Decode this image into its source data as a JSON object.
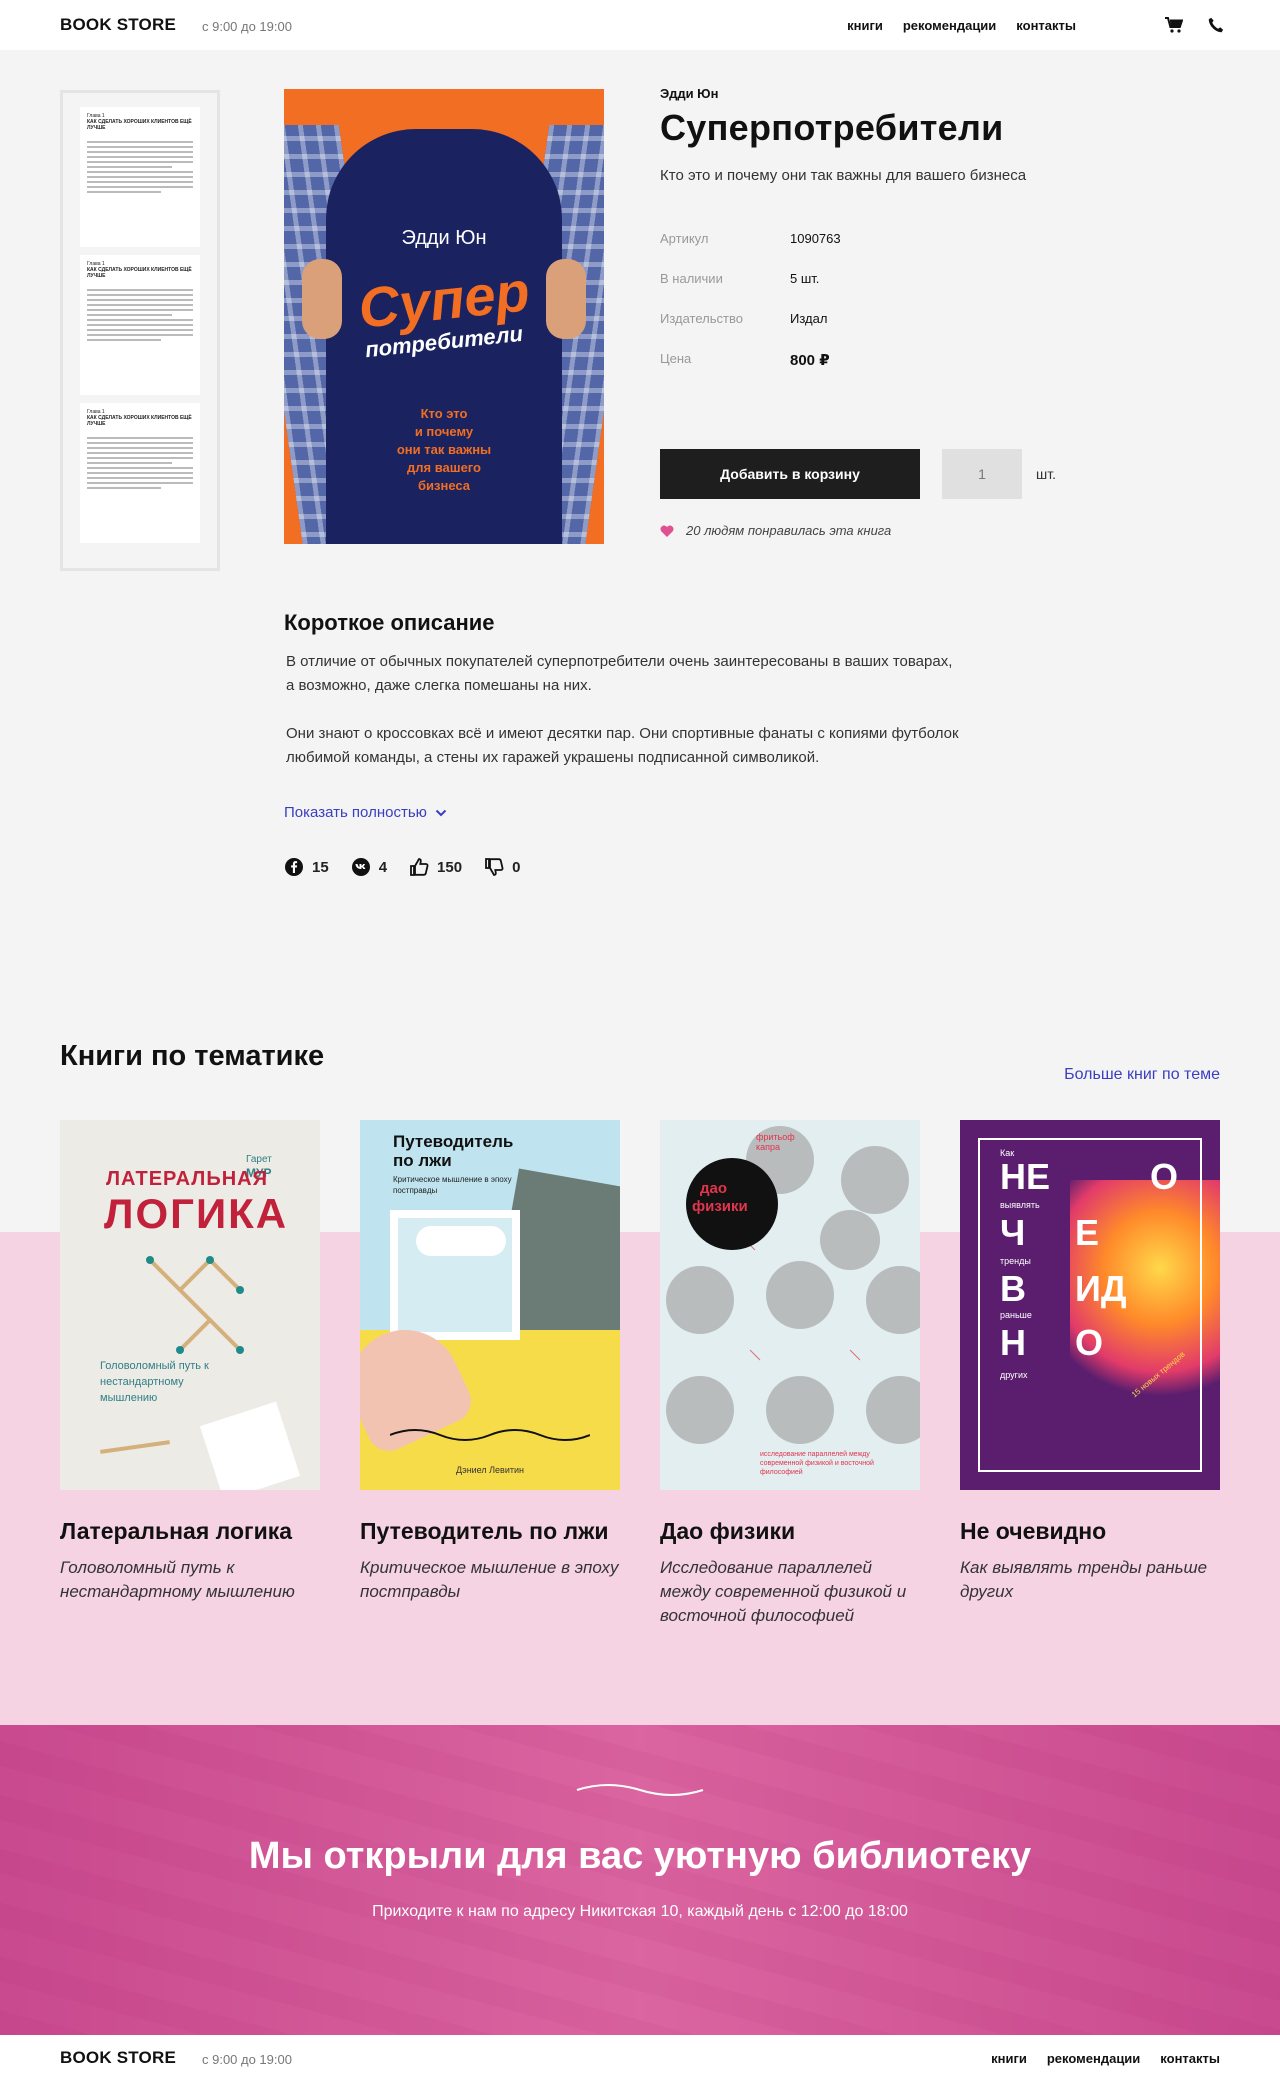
{
  "header": {
    "logo": "BOOK STORE",
    "hours": "с 9:00 до 19:00",
    "nav": [
      "книги",
      "рекомендации",
      "контакты"
    ],
    "icons": [
      "cart-icon",
      "phone-icon"
    ]
  },
  "product": {
    "author": "Эдди Юн",
    "title": "Суперпотребители",
    "subtitle": "Кто это и почему они так важны для вашего бизнеса",
    "specs": [
      {
        "label": "Артикул",
        "value": "1090763"
      },
      {
        "label": "В наличии",
        "value": "5 шт."
      },
      {
        "label": "Издательство",
        "value": "Издал"
      },
      {
        "label": "Цена",
        "value": "800 ₽"
      }
    ],
    "add_to_cart": "Добавить в корзину",
    "quantity": "1",
    "unit": "шт.",
    "likes_text": "20 людям понравилась эта книга",
    "cover": {
      "author": "Эдди Юн",
      "title_line1": "Супер",
      "title_line2": "потребители",
      "subtitle": "Кто это\nи почему\nони так важны\nдля вашего\nбизнеса"
    },
    "preview_pages": [
      {
        "chapter": "Глава 1",
        "heading": "КАК СДЕЛАТЬ ХОРОШИХ КЛИЕНТОВ ЕЩЁ ЛУЧШЕ"
      },
      {
        "chapter": "Глава 1",
        "heading": "КАК СДЕЛАТЬ ХОРОШИХ КЛИЕНТОВ ЕЩЁ ЛУЧШЕ"
      },
      {
        "chapter": "Глава 1",
        "heading": "КАК СДЕЛАТЬ ХОРОШИХ КЛИЕНТОВ ЕЩЁ ЛУЧШЕ"
      }
    ]
  },
  "description": {
    "heading": "Короткое описание",
    "paragraphs": [
      "В отличие от обычных покупателей суперпотребители очень заинтересованы в ваших товарах, а возможно, даже слегка помешаны на них.",
      "Они знают о кроссовках всё и имеют десятки пар. Они спортивные фанаты с копиями футболок любимой команды, а стены их гаражей украшены подписанной символикой."
    ],
    "show_more": "Показать полностью",
    "social": [
      {
        "icon": "facebook-icon",
        "count": "15"
      },
      {
        "icon": "vk-icon",
        "count": "4"
      },
      {
        "icon": "thumbs-up-icon",
        "count": "150"
      },
      {
        "icon": "thumbs-down-icon",
        "count": "0"
      }
    ]
  },
  "related": {
    "heading": "Книги по тематике",
    "more_link": "Больше книг по теме",
    "books": [
      {
        "title": "Латеральная логика",
        "subtitle": "Головоломный путь к нестандартному мышлению",
        "cover": {
          "author_small": "Гарет",
          "author": "МУР",
          "t1": "ЛАТЕРАЛЬНАЯ",
          "t2": "ЛОГИКА",
          "sub": "Головоломный путь к нестандартному мышлению",
          "bg": "#ecebe6",
          "accent": "#c1213a"
        }
      },
      {
        "title": "Путеводитель по лжи",
        "subtitle": "Критическое мышление в эпоху постправды",
        "cover": {
          "t1": "Путеводитель",
          "t2": "по лжи",
          "sub": "Критическое мышление в эпоху постправды",
          "author": "Дэниел Левитин",
          "bg": "#bfe3ef"
        }
      },
      {
        "title": "Дао физики",
        "subtitle": "Исследование параллелей между современной физикой и восточной философией",
        "cover": {
          "author": "фритьоф капра",
          "t1": "дао",
          "t2": "физики",
          "sub": "исследование параллелей между современной физикой и восточной философией",
          "bg": "#e3eef0"
        }
      },
      {
        "title": "Не очевидно",
        "subtitle": "Как выявлять тренды раньше других",
        "cover": {
          "letters": [
            "НЕ",
            "О",
            "Ч",
            "Е",
            "В",
            "ИД",
            "Н",
            "О"
          ],
          "small": [
            "Как",
            "выявлять",
            "тренды",
            "раньше",
            "других"
          ],
          "tag": "15 новых трендов",
          "bg": "#5b1e6e"
        }
      }
    ]
  },
  "banner": {
    "heading": "Мы открыли для вас уютную библиотеку",
    "text": "Приходите к нам по адресу Никитская 10, каждый день с 12:00 до 18:00"
  },
  "footer": {
    "logo": "BOOK STORE",
    "hours": "с 9:00 до 19:00",
    "nav": [
      "книги",
      "рекомендации",
      "контакты"
    ]
  }
}
